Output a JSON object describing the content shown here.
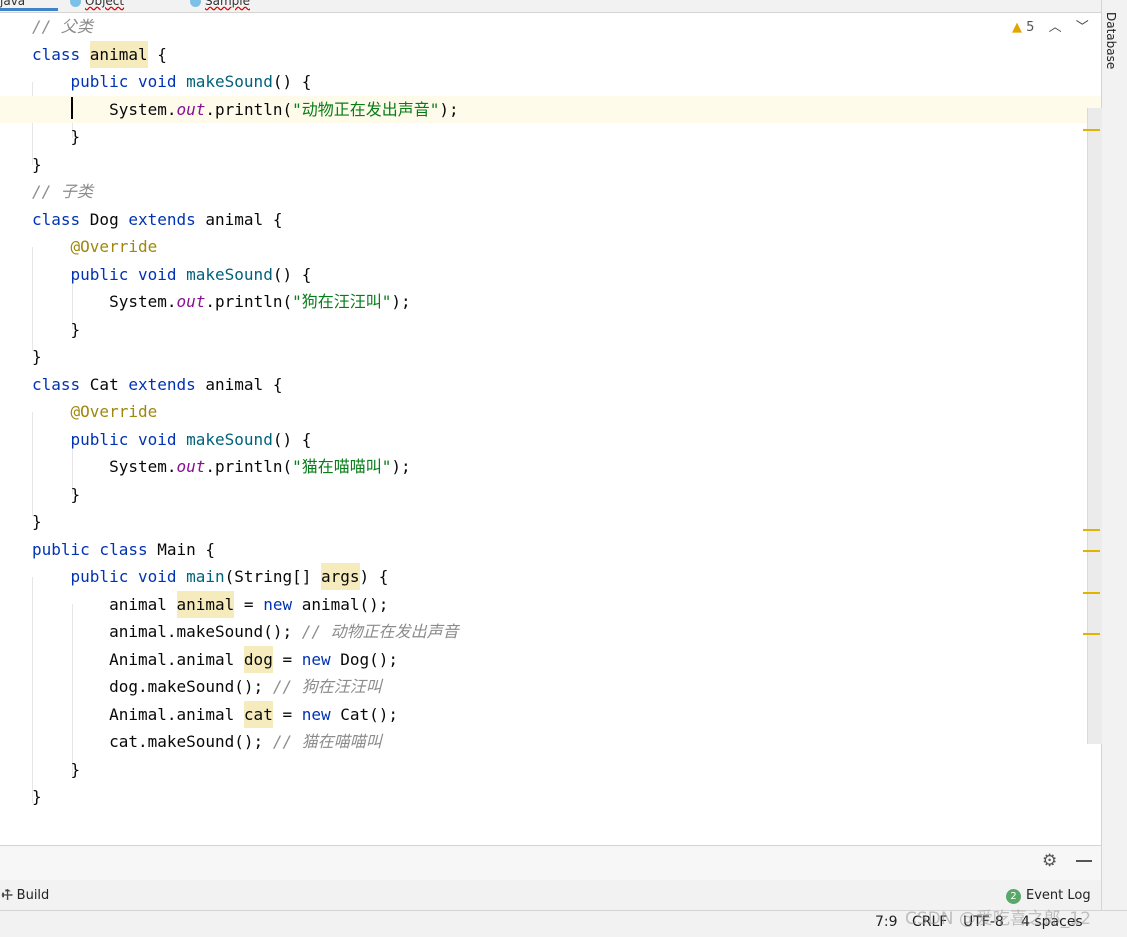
{
  "tabs": [
    {
      "label": "java"
    },
    {
      "label": "Object"
    },
    {
      "label": "Sample"
    }
  ],
  "right_toolbar": {
    "database_label": "Database"
  },
  "inspection": {
    "count": "5",
    "icon": "warning-icon"
  },
  "code": [
    [
      {
        "t": "// 父类",
        "c": "cmt"
      }
    ],
    [
      {
        "t": "class ",
        "c": "kw"
      },
      {
        "t": "animal",
        "c": "hl"
      },
      {
        "t": " {"
      }
    ],
    [
      {
        "t": "    "
      },
      {
        "t": "public void ",
        "c": "kw"
      },
      {
        "t": "makeSound",
        "c": "fn"
      },
      {
        "t": "() {"
      }
    ],
    [
      {
        "t": "        System."
      },
      {
        "t": "out",
        "c": "stat"
      },
      {
        "t": ".println("
      },
      {
        "t": "\"动物正在发出声音\"",
        "c": "str"
      },
      {
        "t": ");"
      }
    ],
    [
      {
        "t": "    }"
      }
    ],
    [
      {
        "t": "}"
      }
    ],
    [
      {
        "t": "// 子类",
        "c": "cmt"
      }
    ],
    [
      {
        "t": "class ",
        "c": "kw"
      },
      {
        "t": "Dog "
      },
      {
        "t": "extends ",
        "c": "kw"
      },
      {
        "t": "animal {"
      }
    ],
    [
      {
        "t": "    "
      },
      {
        "t": "@Override",
        "c": "ann"
      }
    ],
    [
      {
        "t": "    "
      },
      {
        "t": "public void ",
        "c": "kw"
      },
      {
        "t": "makeSound",
        "c": "fn"
      },
      {
        "t": "() {"
      }
    ],
    [
      {
        "t": "        System."
      },
      {
        "t": "out",
        "c": "stat"
      },
      {
        "t": ".println("
      },
      {
        "t": "\"狗在汪汪叫\"",
        "c": "str"
      },
      {
        "t": ");"
      }
    ],
    [
      {
        "t": "    }"
      }
    ],
    [
      {
        "t": "}"
      }
    ],
    [
      {
        "t": "class ",
        "c": "kw"
      },
      {
        "t": "Cat "
      },
      {
        "t": "extends ",
        "c": "kw"
      },
      {
        "t": "animal {"
      }
    ],
    [
      {
        "t": "    "
      },
      {
        "t": "@Override",
        "c": "ann"
      }
    ],
    [
      {
        "t": "    "
      },
      {
        "t": "public void ",
        "c": "kw"
      },
      {
        "t": "makeSound",
        "c": "fn"
      },
      {
        "t": "() {"
      }
    ],
    [
      {
        "t": "        System."
      },
      {
        "t": "out",
        "c": "stat"
      },
      {
        "t": ".println("
      },
      {
        "t": "\"猫在喵喵叫\"",
        "c": "str"
      },
      {
        "t": ");"
      }
    ],
    [
      {
        "t": "    }"
      }
    ],
    [
      {
        "t": "}"
      }
    ],
    [
      {
        "t": "public class ",
        "c": "kw"
      },
      {
        "t": "Main {"
      }
    ],
    [
      {
        "t": "    "
      },
      {
        "t": "public void ",
        "c": "kw"
      },
      {
        "t": "main",
        "c": "fn"
      },
      {
        "t": "(String[] "
      },
      {
        "t": "args",
        "c": "hl"
      },
      {
        "t": ") {"
      }
    ],
    [
      {
        "t": "        animal "
      },
      {
        "t": "animal",
        "c": "hl"
      },
      {
        "t": " = "
      },
      {
        "t": "new ",
        "c": "kw"
      },
      {
        "t": "animal();"
      }
    ],
    [
      {
        "t": "        animal.makeSound(); "
      },
      {
        "t": "// 动物正在发出声音",
        "c": "cmt"
      }
    ],
    [
      {
        "t": "        Animal.animal "
      },
      {
        "t": "dog",
        "c": "hl"
      },
      {
        "t": " = "
      },
      {
        "t": "new ",
        "c": "kw"
      },
      {
        "t": "Dog();"
      }
    ],
    [
      {
        "t": "        dog.makeSound(); "
      },
      {
        "t": "// 狗在汪汪叫",
        "c": "cmt"
      }
    ],
    [
      {
        "t": "        Animal.animal "
      },
      {
        "t": "cat",
        "c": "hl"
      },
      {
        "t": " = "
      },
      {
        "t": "new ",
        "c": "kw"
      },
      {
        "t": "Cat();"
      }
    ],
    [
      {
        "t": "        cat.makeSound(); "
      },
      {
        "t": "// 猫在喵喵叫",
        "c": "cmt"
      }
    ],
    [
      {
        "t": "    }"
      }
    ],
    [
      {
        "t": "}"
      }
    ]
  ],
  "bottom": {
    "build_label": "Build",
    "event_log_label": "Event Log",
    "event_log_count": "2"
  },
  "status": {
    "position": "7:9",
    "line_sep": "CRLF",
    "encoding": "UTF-8",
    "indent": "4 spaces"
  },
  "watermark": "CSDN @爱吃喜之郎_12"
}
